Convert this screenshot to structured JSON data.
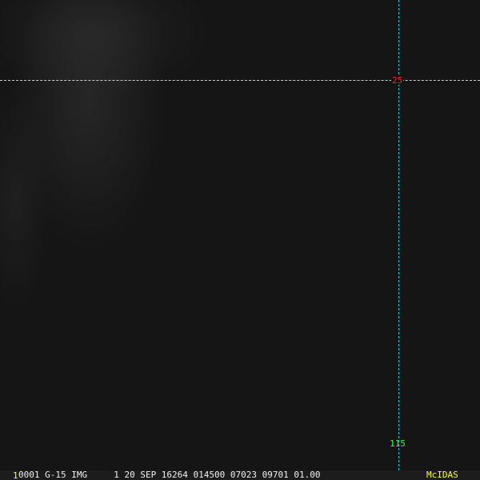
{
  "map": {
    "latitude_label": "25",
    "longitude_label": "115",
    "colors": {
      "latitude_line": "#cfcfcf",
      "longitude_line": "#19c8d8",
      "latitude_text": "#ff2020",
      "longitude_text": "#20ff20"
    }
  },
  "status_bar": {
    "frame_number": "1",
    "info": "0001 G-15 IMG     1 20 SEP 16264 014500 07023 09701 01.00",
    "brand": "McIDAS"
  }
}
